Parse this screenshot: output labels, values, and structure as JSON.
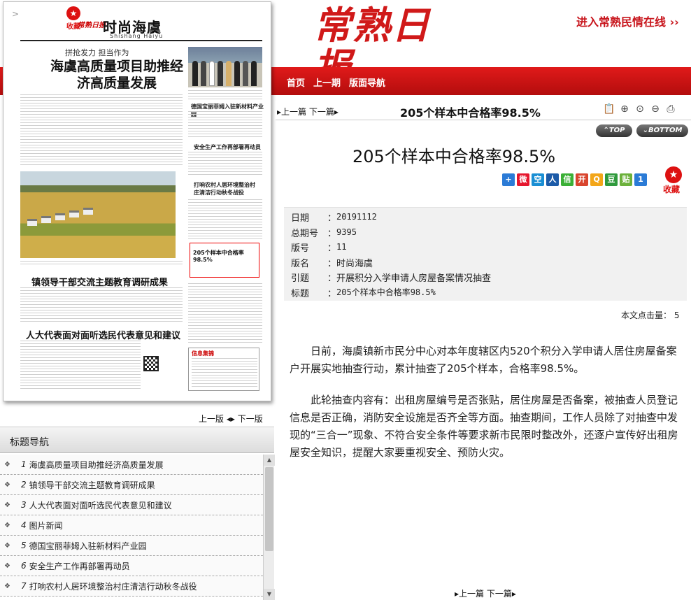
{
  "header": {
    "masthead": "常熟日报",
    "top_link": "进入常熟民情在线 ››"
  },
  "nav": {
    "items": [
      "首页",
      "上一期",
      "版面导航"
    ]
  },
  "paper": {
    "fav_label": "收藏",
    "mini_masthead": "常熟日报",
    "page_name": "时尚海虞",
    "page_pinyin": "Shishang Haiyu",
    "kicker": "拼抢发力 担当作为",
    "head1": "海虞高质量项目助推经济高质量发展",
    "side_head1": "德国宝丽菲姆入驻新材料产业园",
    "side_head2": "安全生产工作再部署再动员",
    "side_head3": "打响农村人居环境整治村庄清洁行动秋冬战役",
    "highlight_title": "205个样本中合格率98.5%",
    "head2": "镇领导干部交流主题教育调研成果",
    "head3": "人大代表面对面听选民代表意见和建议",
    "info_title": "信息集锦"
  },
  "pager": {
    "prev": "上一版",
    "next": "下一版"
  },
  "toc": {
    "title": "标题导航",
    "items": [
      {
        "num": "1",
        "text": "海虞高质量项目助推经济高质量发展"
      },
      {
        "num": "2",
        "text": "镇领导干部交流主题教育调研成果"
      },
      {
        "num": "3",
        "text": "人大代表面对面听选民代表意见和建议"
      },
      {
        "num": "4",
        "text": "图片新闻"
      },
      {
        "num": "5",
        "text": "德国宝丽菲姆入驻新材料产业园"
      },
      {
        "num": "6",
        "text": "安全生产工作再部署再动员"
      },
      {
        "num": "7",
        "text": "打响农村人居环境整治村庄清洁行动秋冬战役"
      }
    ]
  },
  "article": {
    "nav_prev": "上一篇",
    "nav_next": "下一篇",
    "bar_title": "205个样本中合格率98.5%",
    "jump_top": "TOP",
    "jump_bottom": "BOTTOM",
    "title": "205个样本中合格率98.5%",
    "fav_label": "收藏",
    "meta": [
      {
        "k": "日期",
        "v": "20191112",
        "mono": true
      },
      {
        "k": "总期号",
        "v": "9395",
        "mono": true
      },
      {
        "k": "版号",
        "v": "11",
        "mono": true
      },
      {
        "k": "版名",
        "v": "时尚海虞",
        "mono": false
      },
      {
        "k": "引题",
        "v": "开展积分入学申请人房屋备案情况抽查",
        "mono": false
      },
      {
        "k": "标题",
        "v": "205个样本中合格率98.5%",
        "mono": true
      }
    ],
    "clicks": "本文点击量： 5",
    "para1": "日前，海虞镇新市民分中心对本年度辖区内520个积分入学申请人居住房屋备案户开展实地抽查行动，累计抽查了205个样本，合格率98.5%。",
    "para2": "此轮抽查内容有：出租房屋编号是否张贴，居住房屋是否备案，被抽查人员登记信息是否正确，消防安全设施是否齐全等方面。抽查期间，工作人员除了对抽查中发现的“三合一”现象、不符合安全条件等要求新市民限时整改外，还逐户宣传好出租房屋安全知识，提醒大家要重视安全、预防火灾。"
  },
  "colors": {
    "brand_red": "#d01919",
    "nav_red": "#c8161d"
  }
}
